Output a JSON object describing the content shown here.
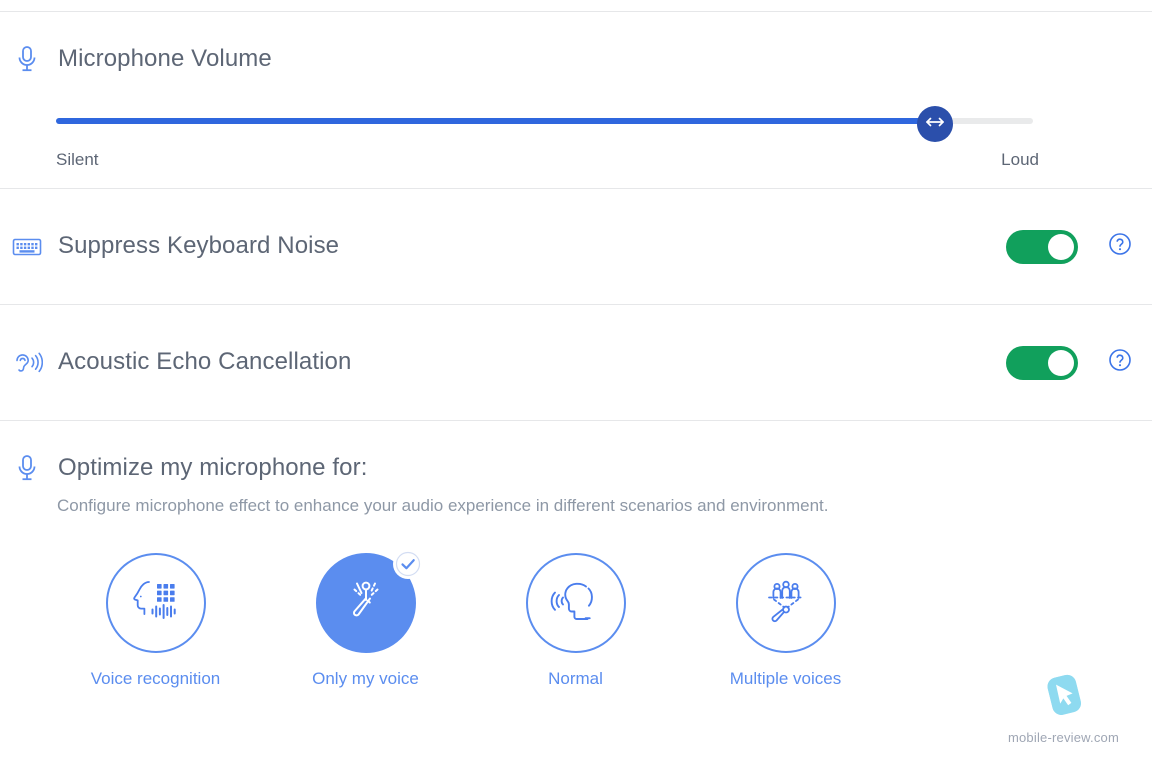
{
  "accent": {
    "blue": "#5b8def",
    "slider_fill": "#2f67de",
    "slider_thumb": "#2b4fab",
    "toggle_on": "#11a05c",
    "title_text": "#5d6675",
    "muted_text": "#8e98a6",
    "divider": "#e6e7e9",
    "track_empty": "#e9eaeb"
  },
  "volume_section": {
    "icon": "microphone-icon",
    "title": "Microphone Volume",
    "slider": {
      "value_percent": 90,
      "min_label": "Silent",
      "max_label": "Loud",
      "thumb_icon": "horizontal-resize-arrows-icon"
    }
  },
  "toggle_rows": [
    {
      "icon": "keyboard-icon",
      "title": "Suppress Keyboard Noise",
      "toggle_state": "on",
      "help_icon": "question-circle-icon"
    },
    {
      "icon": "ear-soundwaves-icon",
      "title": "Acoustic Echo Cancellation",
      "toggle_state": "on",
      "help_icon": "question-circle-icon"
    }
  ],
  "optimize_section": {
    "icon": "microphone-icon",
    "title": "Optimize my microphone for:",
    "description": "Configure microphone effect to enhance your audio experience in different scenarios and environment.",
    "options": [
      {
        "label": "Voice recognition",
        "icon": "face-binary-waveform-icon",
        "selected": false
      },
      {
        "label": "Only my voice",
        "icon": "single-voice-mic-icon",
        "selected": true
      },
      {
        "label": "Normal",
        "icon": "head-speaking-icon",
        "selected": false
      },
      {
        "label": "Multiple voices",
        "icon": "group-voices-mic-icon",
        "selected": false
      }
    ],
    "selected_badge_icon": "check-circle-icon"
  },
  "watermark": {
    "icon": "cursor-tile-icon",
    "text": "mobile-review.com"
  }
}
